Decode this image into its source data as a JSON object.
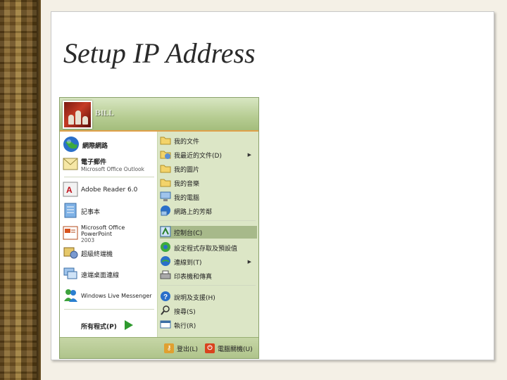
{
  "slide": {
    "title": "Setup IP Address"
  },
  "start_menu": {
    "user_name": "BILL",
    "pinned": [
      {
        "label": "網際網路",
        "sub": "",
        "icon": "globe-icon"
      },
      {
        "label": "電子郵件",
        "sub": "Microsoft Office Outlook",
        "icon": "mail-icon"
      }
    ],
    "recent": [
      {
        "label": "Adobe Reader 6.0",
        "icon": "adobe-reader-icon"
      },
      {
        "label": "記事本",
        "icon": "notepad-icon"
      },
      {
        "label": "Microsoft Office PowerPoint",
        "sub": "2003",
        "icon": "powerpoint-icon"
      },
      {
        "label": "超級終端機",
        "icon": "hyperterminal-icon"
      },
      {
        "label": "遠端桌面連線",
        "icon": "remote-desktop-icon"
      },
      {
        "label": "Windows Live Messenger",
        "icon": "messenger-icon"
      }
    ],
    "all_programs": "所有程式(P)",
    "right_items": [
      {
        "label": "我的文件",
        "icon": "folder-documents-icon",
        "submenu": false
      },
      {
        "label": "我最近的文件(D)",
        "icon": "recent-documents-icon",
        "submenu": true
      },
      {
        "label": "我的圖片",
        "icon": "folder-pictures-icon",
        "submenu": false
      },
      {
        "label": "我的音樂",
        "icon": "folder-music-icon",
        "submenu": false
      },
      {
        "label": "我的電腦",
        "icon": "my-computer-icon",
        "submenu": false
      },
      {
        "label": "網路上的芳鄰",
        "icon": "network-places-icon",
        "submenu": false
      },
      {
        "label": "控制台(C)",
        "icon": "control-panel-icon",
        "submenu": false,
        "highlighted": true
      },
      {
        "label": "設定程式存取及預設值",
        "icon": "program-defaults-icon",
        "submenu": false
      },
      {
        "label": "連線到(T)",
        "icon": "connect-to-icon",
        "submenu": true
      },
      {
        "label": "印表機和傳真",
        "icon": "printer-icon",
        "submenu": false
      },
      {
        "label": "說明及支援(H)",
        "icon": "help-icon",
        "submenu": false
      },
      {
        "label": "搜尋(S)",
        "icon": "search-icon",
        "submenu": false
      },
      {
        "label": "執行(R)",
        "icon": "run-icon",
        "submenu": false
      }
    ],
    "footer": {
      "logoff": "登出(L)",
      "shutdown": "電腦關機(U)"
    },
    "colors": {
      "highlight": "#a7b98a",
      "footer": "#aec38a",
      "accent": "#e0a04a"
    }
  }
}
